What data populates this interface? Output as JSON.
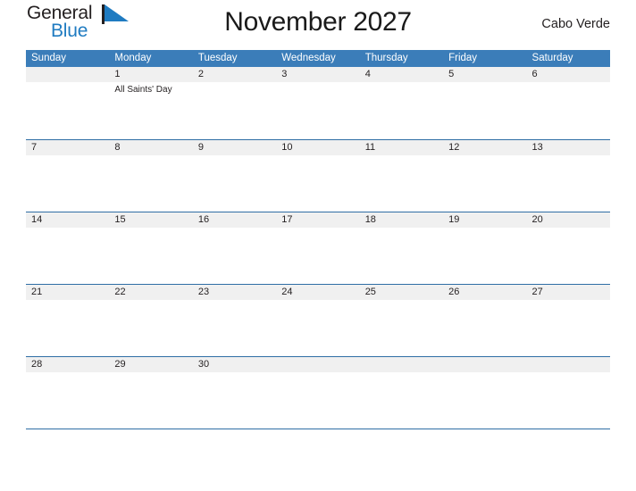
{
  "brand": {
    "name_part1": "General",
    "name_part2": "Blue",
    "flag_icon": "blue-triangle-flag-icon",
    "accent_color": "#1f7bc1"
  },
  "header": {
    "title": "November 2027",
    "region": "Cabo Verde"
  },
  "theme": {
    "header_blue": "#3b7db9",
    "grid_line_blue": "#2f6ea5",
    "date_band_gray": "#f0f0f0",
    "text_color": "#231f20",
    "page_background": "#ffffff"
  },
  "calendar": {
    "month": "November",
    "year": "2027",
    "weekday_headers": [
      "Sunday",
      "Monday",
      "Tuesday",
      "Wednesday",
      "Thursday",
      "Friday",
      "Saturday"
    ],
    "weeks": [
      {
        "days": [
          {
            "date": "",
            "events": []
          },
          {
            "date": "1",
            "events": [
              "All Saints' Day"
            ]
          },
          {
            "date": "2",
            "events": []
          },
          {
            "date": "3",
            "events": []
          },
          {
            "date": "4",
            "events": []
          },
          {
            "date": "5",
            "events": []
          },
          {
            "date": "6",
            "events": []
          }
        ]
      },
      {
        "days": [
          {
            "date": "7",
            "events": []
          },
          {
            "date": "8",
            "events": []
          },
          {
            "date": "9",
            "events": []
          },
          {
            "date": "10",
            "events": []
          },
          {
            "date": "11",
            "events": []
          },
          {
            "date": "12",
            "events": []
          },
          {
            "date": "13",
            "events": []
          }
        ]
      },
      {
        "days": [
          {
            "date": "14",
            "events": []
          },
          {
            "date": "15",
            "events": []
          },
          {
            "date": "16",
            "events": []
          },
          {
            "date": "17",
            "events": []
          },
          {
            "date": "18",
            "events": []
          },
          {
            "date": "19",
            "events": []
          },
          {
            "date": "20",
            "events": []
          }
        ]
      },
      {
        "days": [
          {
            "date": "21",
            "events": []
          },
          {
            "date": "22",
            "events": []
          },
          {
            "date": "23",
            "events": []
          },
          {
            "date": "24",
            "events": []
          },
          {
            "date": "25",
            "events": []
          },
          {
            "date": "26",
            "events": []
          },
          {
            "date": "27",
            "events": []
          }
        ]
      },
      {
        "days": [
          {
            "date": "28",
            "events": []
          },
          {
            "date": "29",
            "events": []
          },
          {
            "date": "30",
            "events": []
          },
          {
            "date": "",
            "events": []
          },
          {
            "date": "",
            "events": []
          },
          {
            "date": "",
            "events": []
          },
          {
            "date": "",
            "events": []
          }
        ]
      }
    ]
  }
}
